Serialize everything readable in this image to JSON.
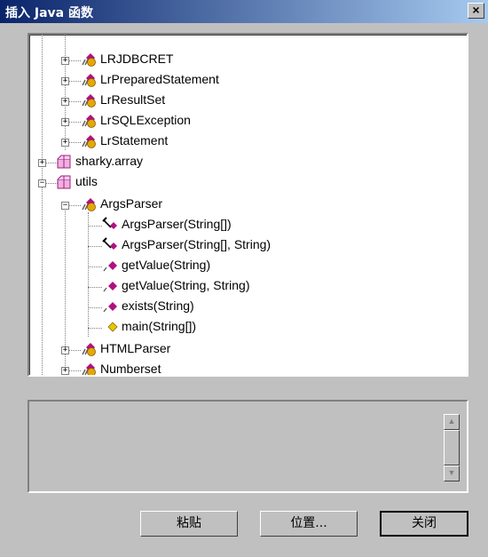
{
  "window": {
    "title": "插入 Java 函数",
    "close_glyph": "×"
  },
  "tree": {
    "items": [
      {
        "label": "LRJDBCRET",
        "icon": "class-icon"
      },
      {
        "label": "LrPreparedStatement",
        "icon": "class-icon"
      },
      {
        "label": "LrResultSet",
        "icon": "class-icon"
      },
      {
        "label": "LrSQLException",
        "icon": "class-icon"
      },
      {
        "label": "LrStatement",
        "icon": "class-icon"
      },
      {
        "label": "sharky.array",
        "icon": "package-icon"
      },
      {
        "label": "utils",
        "icon": "package-icon"
      },
      {
        "label": "ArgsParser",
        "icon": "class-icon"
      },
      {
        "label": "ArgsParser(String[])",
        "icon": "constructor-icon"
      },
      {
        "label": "ArgsParser(String[], String)",
        "icon": "constructor-icon"
      },
      {
        "label": "getValue(String)",
        "icon": "method-icon"
      },
      {
        "label": "getValue(String, String)",
        "icon": "method-icon"
      },
      {
        "label": "exists(String)",
        "icon": "method-icon"
      },
      {
        "label": "main(String[])",
        "icon": "static-method-icon"
      },
      {
        "label": "HTMLParser",
        "icon": "class-icon"
      },
      {
        "label": "Numberset",
        "icon": "class-icon"
      }
    ]
  },
  "buttons": {
    "paste": "粘贴",
    "position": "位置...",
    "close": "关闭"
  },
  "colors": {
    "title_start": "#0a246a",
    "title_end": "#a6caf0",
    "class_icon": "#e6a800",
    "method_icon": "#b01080"
  }
}
